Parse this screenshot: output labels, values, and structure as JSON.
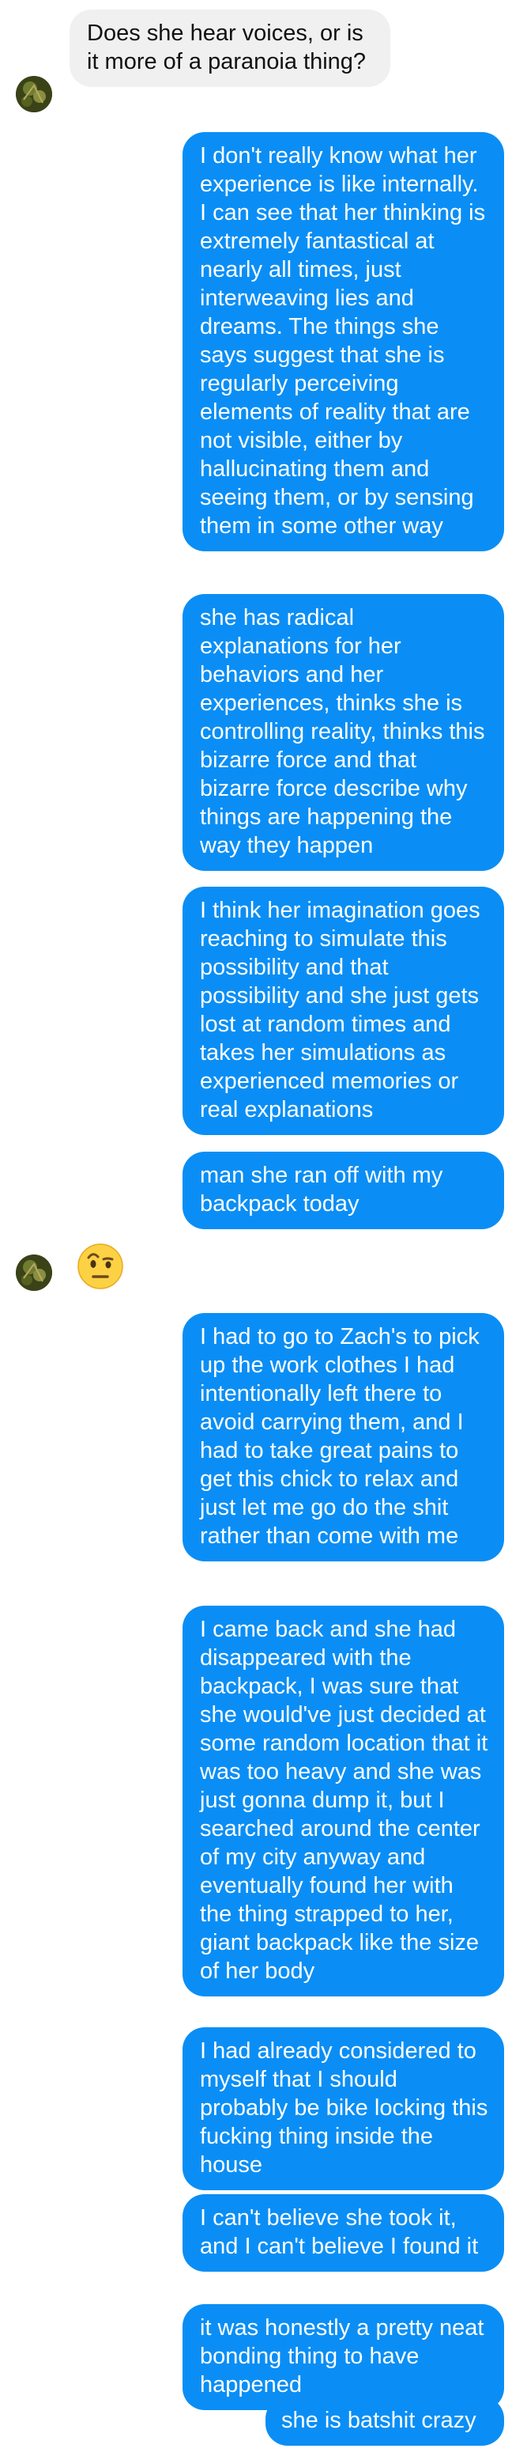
{
  "colors": {
    "outgoing_bubble": "#0a8ef5",
    "incoming_bubble": "#f0f0f0",
    "background": "#ffffff"
  },
  "messages": [
    {
      "sender": "them",
      "text": "Does she hear voices, or is it more of a paranoia thing?"
    },
    {
      "sender": "me",
      "text": "I don't really know what her experience is like internally. I can see that her thinking is extremely fantastical at nearly all times, just interweaving lies and dreams. The things she says suggest that she is regularly perceiving elements of reality that are not visible, either by hallucinating them and seeing them, or by sensing them in some other way"
    },
    {
      "sender": "me",
      "text": "she has radical explanations for her behaviors and her experiences, thinks she is controlling reality, thinks this bizarre force and that bizarre force describe why things are happening the way they happen"
    },
    {
      "sender": "me",
      "text": "I think her imagination goes reaching to simulate this possibility and that possibility and she just gets lost at random times and takes her simulations as experienced memories or real explanations"
    },
    {
      "sender": "me",
      "text": "man she ran off with my backpack today"
    },
    {
      "sender": "them",
      "emoji": "face-with-raised-eyebrow"
    },
    {
      "sender": "me",
      "text": "I had to go to Zach's to pick up the work clothes I had intentionally left there to avoid carrying them, and I had to take great pains to get this chick to relax and just let me go do the shit rather than come with me"
    },
    {
      "sender": "me",
      "text": "I came back and she had disappeared with the backpack, I was sure that she would've just decided at some random location that it was too heavy and she was just gonna dump it, but I searched around the center of my city anyway and eventually found her with the thing strapped to her, giant backpack like the size of her body"
    },
    {
      "sender": "me",
      "text": "I had already considered to myself that I should probably be bike locking this fucking thing inside the house"
    },
    {
      "sender": "me",
      "text": "I can't believe she took it, and I can't believe I found it"
    },
    {
      "sender": "me",
      "text": "it was honestly a pretty neat bonding thing to have happened"
    },
    {
      "sender": "me",
      "text": "she is batshit crazy"
    }
  ]
}
